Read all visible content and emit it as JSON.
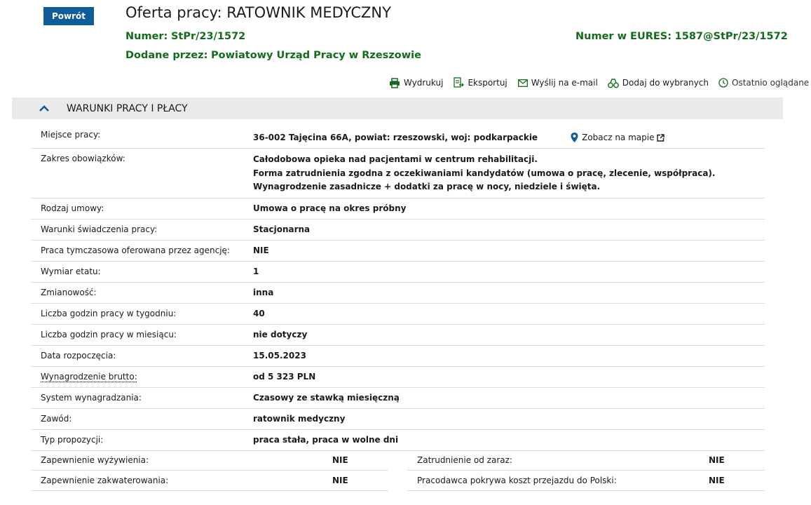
{
  "back_button": "Powrót",
  "header": {
    "title": "Oferta pracy: RATOWNIK MEDYCZNY",
    "numer_label": "Numer:",
    "numer_value": "StPr/23/1572",
    "eures_label": "Numer w EURES:",
    "eures_value": "1587@StPr/23/1572",
    "added_label": "Dodane przez:",
    "added_value": "Powiatowy Urząd Pracy w Rzeszowie"
  },
  "toolbar": {
    "print": "Wydrukuj",
    "export": "Eksportuj",
    "email": "Wyślij na e-mail",
    "favorites": "Dodaj do wybranych",
    "recent": "Ostatnio oglądane"
  },
  "section": {
    "title": "WARUNKI PRACY I PŁACY",
    "map_link": "Zobacz na mapie",
    "rows": [
      {
        "label": "Miejsce pracy:",
        "value": "36-002 Tajęcina 66A, powiat: rzeszowski, woj: podkarpackie"
      },
      {
        "label": "Zakres obowiązków:",
        "lines": [
          "Całodobowa opieka nad pacjentami w centrum rehabilitacji.",
          "Forma zatrudnienia zgodna z oczekiwaniami kandydatów (umowa o pracę, zlecenie, współpraca).",
          "Wynagrodzenie zasadnicze + dodatki za pracę w nocy, niedziele i święta."
        ]
      },
      {
        "label": "Rodzaj umowy:",
        "value": "Umowa o pracę na okres próbny"
      },
      {
        "label": "Warunki świadczenia pracy:",
        "value": "Stacjonarna"
      },
      {
        "label": "Praca tymczasowa oferowana przez agencję:",
        "value": "NIE"
      },
      {
        "label": "Wymiar etatu:",
        "value": "1"
      },
      {
        "label": "Zmianowość:",
        "value": "inna"
      },
      {
        "label": "Liczba godzin pracy w tygodniu:",
        "value": "40"
      },
      {
        "label": "Liczba godzin pracy w miesiącu:",
        "value": "nie dotyczy"
      },
      {
        "label": "Data rozpoczęcia:",
        "value": "15.05.2023"
      },
      {
        "label": "Wynagrodzenie brutto:",
        "value": "od 5 323 PLN"
      },
      {
        "label": "System wynagradzania:",
        "value": "Czasowy ze stawką miesięczną"
      },
      {
        "label": "Zawód:",
        "value": "ratownik medyczny"
      },
      {
        "label": "Typ propozycji:",
        "value": "praca stała, praca w wolne dni"
      }
    ],
    "pairs": [
      {
        "left_label": "Zapewnienie wyżywienia:",
        "left_value": "NIE",
        "right_label": "Zatrudnienie od zaraz:",
        "right_value": "NIE"
      },
      {
        "left_label": "Zapewnienie zakwaterowania:",
        "left_value": "NIE",
        "right_label": "Pracodawca pokrywa koszt przejazdu do Polski:",
        "right_value": "NIE"
      }
    ]
  },
  "colors": {
    "primary_blue": "#0f5c97",
    "green": "#136c1c",
    "section_bg": "#eaeaea"
  }
}
